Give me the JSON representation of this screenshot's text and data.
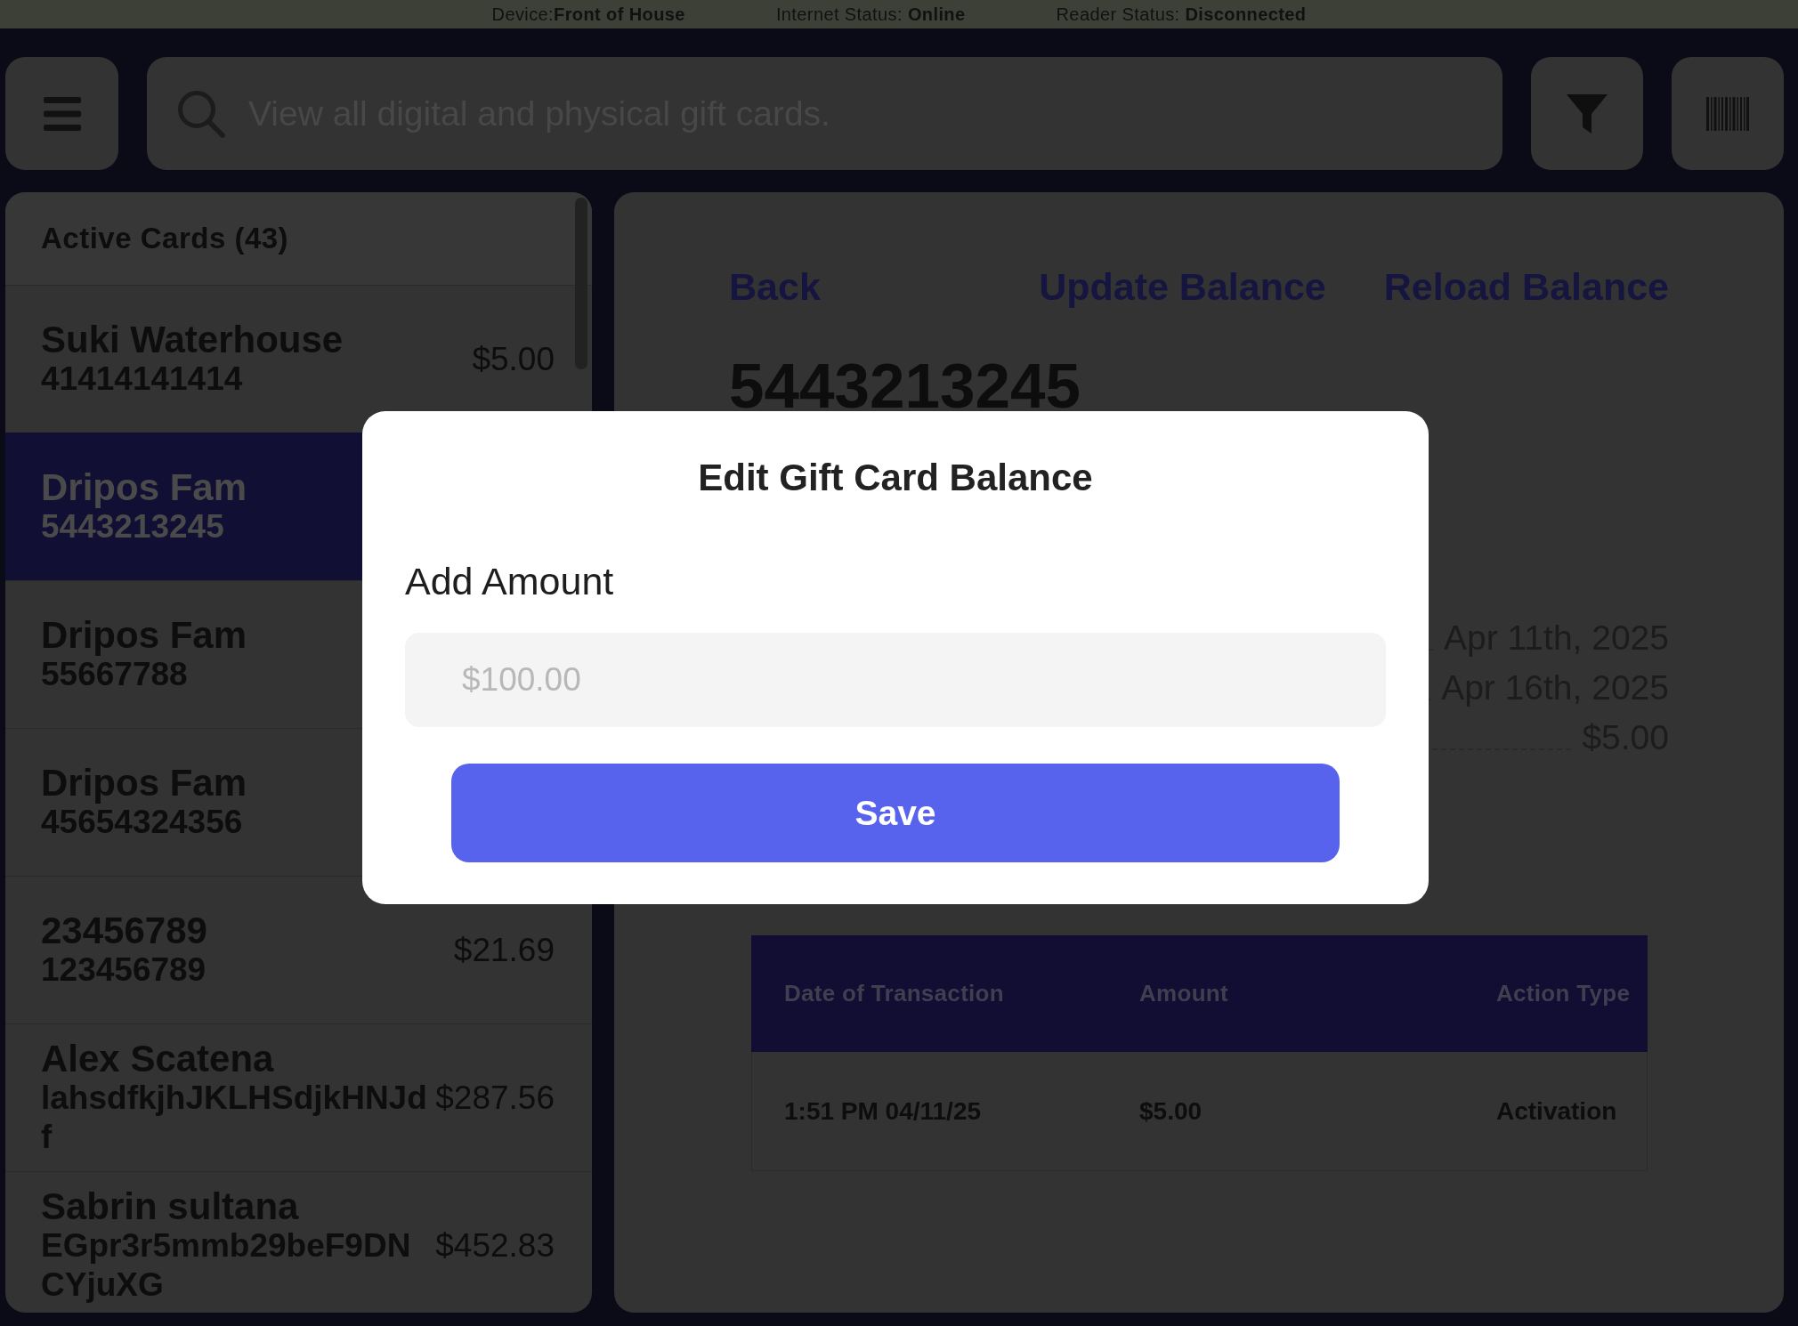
{
  "status_bar": {
    "items": [
      "Device:**Front of House**",
      "Internet Status: **Online**",
      "Reader Status: **Disconnected**"
    ]
  },
  "toolbar": {
    "search": {
      "placeholder": "View all digital and physical gift cards."
    }
  },
  "card_list": {
    "title": "Active Cards (43)",
    "items": [
      {
        "name": "Suki Waterhouse",
        "number": "41414141414",
        "balance": "$5.00",
        "selected": false
      },
      {
        "name": "Dripos Fam",
        "number": "5443213245",
        "selected": true
      },
      {
        "name": "Dripos Fam",
        "number": "55667788",
        "selected": false
      },
      {
        "name": "Dripos Fam",
        "number": "45654324356",
        "selected": false
      },
      {
        "name": "23456789",
        "number": "123456789",
        "balance": "$21.69",
        "selected": false
      },
      {
        "name": "Alex Scatena",
        "number": "lahsdfkjhJKLHSdjkHNJdf",
        "balance": "$287.56",
        "selected": false
      },
      {
        "name": "Sabrin sultana",
        "number": "EGpr3r5mmb29beF9DNCYjuXG",
        "balance": "$452.83",
        "selected": false
      }
    ]
  },
  "detail": {
    "actions": [
      "Back",
      "Update Balance",
      "Reload Balance"
    ],
    "card_number": "5443213245",
    "info_rows": [
      {
        "value": "Apr 11th, 2025"
      },
      {
        "value": "Apr 16th, 2025"
      },
      {
        "value": "$5.00"
      }
    ],
    "transactions": {
      "columns": [
        "Date of Transaction",
        "Amount",
        "Action Type"
      ],
      "rows": [
        [
          "1:51 PM 04/11/25",
          "$5.00",
          "Activation"
        ]
      ]
    }
  },
  "modal": {
    "title": "Edit Gift Card Balance",
    "field_label": "Add Amount",
    "amount_field": {
      "placeholder": "$100.00"
    },
    "save_button": "Save"
  }
}
